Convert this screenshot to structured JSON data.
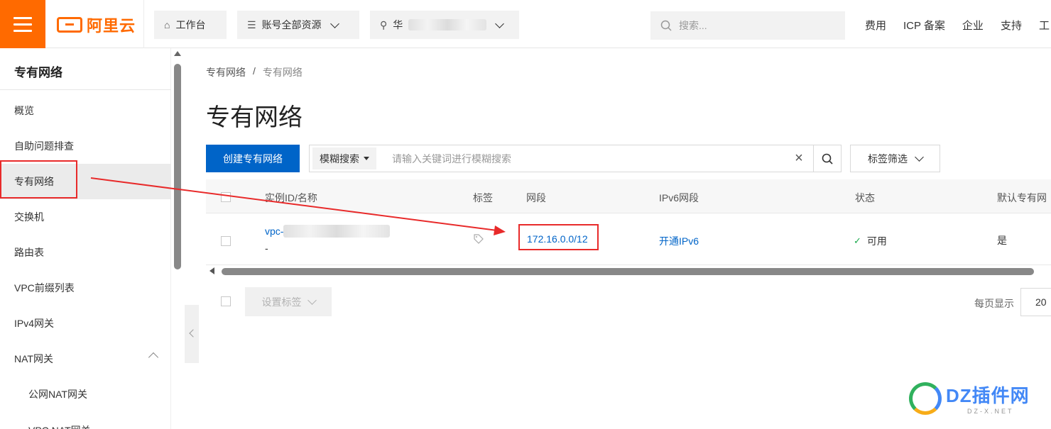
{
  "topbar": {
    "logo": "阿里云",
    "workbench": "工作台",
    "resources": "账号全部资源",
    "region_prefix": "华",
    "search_placeholder": "搜索...",
    "links": [
      "费用",
      "ICP 备案",
      "企业",
      "支持",
      "工"
    ]
  },
  "sidebar": {
    "title": "专有网络",
    "items": [
      "概览",
      "自助问题排查",
      "专有网络",
      "交换机",
      "路由表",
      "VPC前缀列表",
      "IPv4网关",
      "NAT网关",
      "公网NAT网关",
      "VPC NAT网关"
    ],
    "active_index": 2
  },
  "breadcrumb": [
    "专有网络",
    "/",
    "专有网络"
  ],
  "page_title": "专有网络",
  "toolbar": {
    "create_label": "创建专有网络",
    "search_mode": "模糊搜索",
    "search_placeholder": "请输入关键词进行模糊搜索",
    "clear_icon": "×",
    "tag_filter_label": "标签筛选"
  },
  "table": {
    "columns": [
      "实例ID/名称",
      "标签",
      "网段",
      "IPv6网段",
      "状态",
      "默认专有网"
    ],
    "rows": [
      {
        "id_prefix": "vpc-",
        "name": "-",
        "cidr": "172.16.0.0/12",
        "ipv6": "开通IPv6",
        "status": "可用",
        "status_icon": "✓",
        "default": "是"
      }
    ]
  },
  "footer": {
    "set_tags_label": "设置标签",
    "per_page_label": "每页显示",
    "page_size": "20"
  },
  "watermark": {
    "main": "DZ插件网",
    "sub": "DZ-X.NET"
  },
  "colors": {
    "brand_orange": "#ff6a00",
    "primary_blue": "#0064c8",
    "annotation_red": "#e82a2a",
    "status_green": "#1aa94c"
  }
}
